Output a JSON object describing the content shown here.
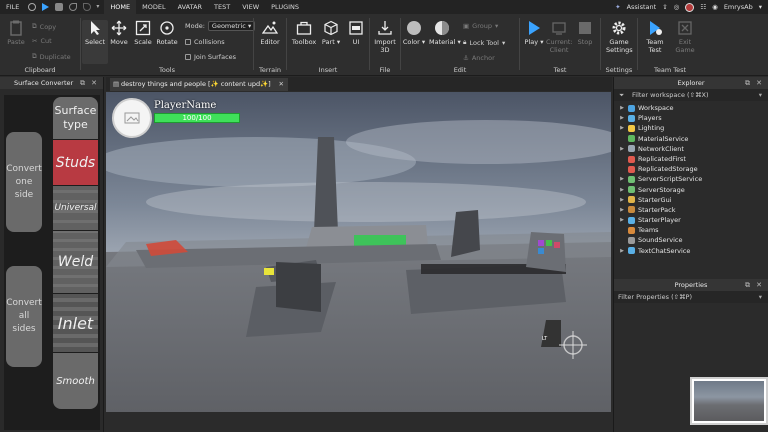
{
  "menu": {
    "file": "FILE",
    "tabs": [
      "HOME",
      "MODEL",
      "AVATAR",
      "TEST",
      "VIEW",
      "PLUGINS"
    ],
    "active_tab": "HOME",
    "assistant": "Assistant",
    "user": "EmrysAb"
  },
  "ribbon": {
    "clipboard": {
      "label": "Clipboard",
      "paste": "Paste",
      "copy": "Copy",
      "cut": "Cut",
      "duplicate": "Duplicate"
    },
    "tools": {
      "label": "Tools",
      "select": "Select",
      "move": "Move",
      "scale": "Scale",
      "rotate": "Rotate",
      "mode_label": "Mode:",
      "mode_value": "Geometric",
      "collisions": "Collisions",
      "join_surfaces": "Join Surfaces"
    },
    "terrain": {
      "label": "Terrain",
      "editor": "Editor"
    },
    "insert": {
      "label": "Insert",
      "toolbox": "Toolbox",
      "part": "Part",
      "ui": "UI"
    },
    "file": {
      "label": "File",
      "import3d_line1": "Import",
      "import3d_line2": "3D"
    },
    "edit": {
      "label": "Edit",
      "color": "Color",
      "material": "Material",
      "group": "Group",
      "lock_tool": "Lock Tool",
      "anchor": "Anchor"
    },
    "test": {
      "label": "Test",
      "play": "Play",
      "current_line1": "Current:",
      "current_line2": "Client",
      "stop": "Stop"
    },
    "settings": {
      "label": "Settings",
      "game_settings_line1": "Game",
      "game_settings_line2": "Settings"
    },
    "team_test": {
      "label": "Team Test",
      "team_line1": "Team",
      "team_line2": "Test",
      "exit_line1": "Exit",
      "exit_line2": "Game"
    }
  },
  "left_panel": {
    "title": "Surface Converter",
    "convert_one": [
      "Convert",
      "one",
      "side"
    ],
    "convert_all": [
      "Convert",
      "all",
      "sides"
    ],
    "surface_type": [
      "Surface",
      "type"
    ],
    "types": [
      "Studs",
      "Universal",
      "Weld",
      "Inlet",
      "Smooth"
    ]
  },
  "viewport": {
    "tab_title": "destroy things and people [✨ content upd✨]",
    "player_name": "PlayerName",
    "health": "100/100",
    "health_fraction": 1.0,
    "lt_label": "LT"
  },
  "explorer": {
    "title": "Explorer",
    "filter_placeholder": "Filter workspace (⇧⌘X)",
    "items": [
      {
        "label": "Workspace",
        "icon": "globe-icon",
        "color": "#4da3e0",
        "expandable": true
      },
      {
        "label": "Players",
        "icon": "players-icon",
        "color": "#5ab0e6",
        "expandable": true
      },
      {
        "label": "Lighting",
        "icon": "lightbulb-icon",
        "color": "#f2c744",
        "expandable": true
      },
      {
        "label": "MaterialService",
        "icon": "material-icon",
        "color": "#5fb760",
        "expandable": false
      },
      {
        "label": "NetworkClient",
        "icon": "network-icon",
        "color": "#9aa6b2",
        "expandable": true
      },
      {
        "label": "ReplicatedFirst",
        "icon": "replicated-icon",
        "color": "#e05a4f",
        "expandable": false
      },
      {
        "label": "ReplicatedStorage",
        "icon": "storage-icon",
        "color": "#e05a4f",
        "expandable": false
      },
      {
        "label": "ServerScriptService",
        "icon": "script-service-icon",
        "color": "#6fbf73",
        "expandable": true
      },
      {
        "label": "ServerStorage",
        "icon": "server-storage-icon",
        "color": "#6fbf73",
        "expandable": true
      },
      {
        "label": "StarterGui",
        "icon": "gui-icon",
        "color": "#e0b44a",
        "expandable": true
      },
      {
        "label": "StarterPack",
        "icon": "pack-icon",
        "color": "#c88a3d",
        "expandable": true
      },
      {
        "label": "StarterPlayer",
        "icon": "player-icon",
        "color": "#5ab0e6",
        "expandable": true
      },
      {
        "label": "Teams",
        "icon": "teams-icon",
        "color": "#d88a3c",
        "expandable": false
      },
      {
        "label": "SoundService",
        "icon": "sound-icon",
        "color": "#9a9a9a",
        "expandable": false
      },
      {
        "label": "TextChatService",
        "icon": "chat-icon",
        "color": "#5ab0e6",
        "expandable": true
      }
    ]
  },
  "properties": {
    "title": "Properties",
    "filter_placeholder": "Filter Properties (⇧⌘P)"
  }
}
